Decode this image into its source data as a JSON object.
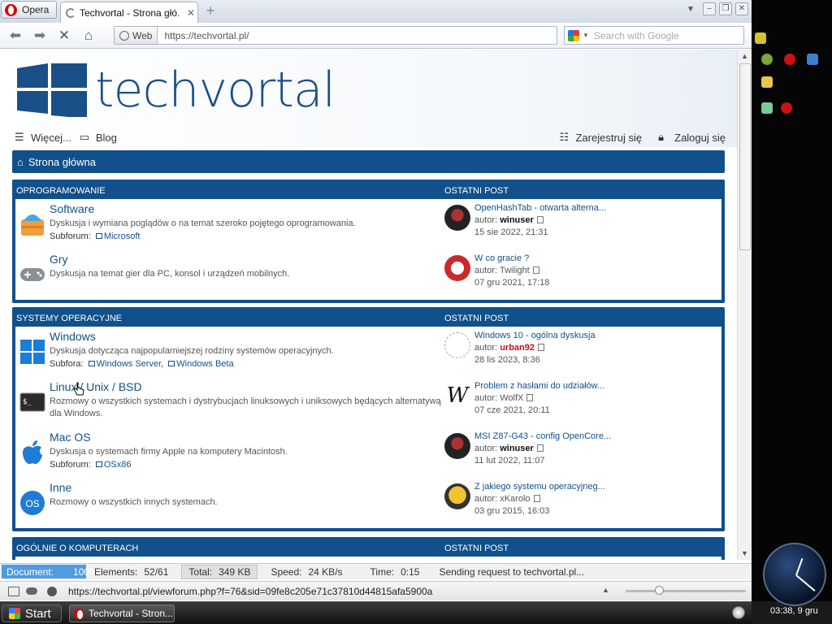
{
  "browser": {
    "menu_label": "Opera",
    "tab_title": "Techvortal - Strona głó...",
    "web_badge": "Web",
    "url": "https://techvortal.pl/",
    "search_placeholder": "Search with Google"
  },
  "site": {
    "logo_text": "techvortal",
    "nav_more": "Więcej...",
    "nav_blog": "Blog",
    "register": "Zarejestruj się",
    "login": "Zaloguj się",
    "breadcrumb": "Strona główna",
    "colors": {
      "primary": "#11508a",
      "author_red": "#c0151b"
    }
  },
  "categories": [
    {
      "title": "OPROGRAMOWANIE",
      "last_post_header": "OSTATNI POST",
      "forums": [
        {
          "icon": "software-box-icon",
          "title": "Software",
          "desc": "Dyskusja i wymiana poglądów o na temat szeroko pojętego oprogramowania.",
          "subforum_label": "Subforum:",
          "subforums": [
            "Microsoft"
          ],
          "last": {
            "title": "OpenHashTab - otwarta alterna...",
            "author_prefix": "autor:",
            "author": "winuser",
            "date": "15 sie 2022, 21:31"
          }
        },
        {
          "icon": "gamepad-icon",
          "title": "Gry",
          "desc": "Dyskusja na temat gier dla PC, konsol i urządzeń mobilnych.",
          "subforum_label": "",
          "subforums": [],
          "last": {
            "title": "W co gracie ?",
            "author_prefix": "autor:",
            "author": "Twilight",
            "date": "07 gru 2021, 17:18"
          }
        }
      ]
    },
    {
      "title": "SYSTEMY OPERACYJNE",
      "last_post_header": "OSTATNI POST",
      "forums": [
        {
          "icon": "windows-logo-icon",
          "title": "Windows",
          "desc": "Dyskusja dotycząca najpopularniejszej rodziny systemów operacyjnych.",
          "subforum_label": "Subfora:",
          "subforums": [
            "Windows Server",
            "Windows Beta"
          ],
          "last": {
            "title": "Windows 10 - ogólna dyskusja",
            "author_prefix": "autor:",
            "author": "urban92",
            "date": "28 lis 2023, 8:36"
          }
        },
        {
          "icon": "terminal-icon",
          "title": "Linux / Unix / BSD",
          "desc": "Rozmowy o wszystkich systemach i dystrybucjach linuksowych i uniksowych będących alternatywą dla Windows.",
          "subforum_label": "",
          "subforums": [],
          "last": {
            "title": "Problem z hasłami do udziałów...",
            "author_prefix": "autor:",
            "author": "WolfX",
            "date": "07 cze 2021, 20:11"
          }
        },
        {
          "icon": "apple-logo-icon",
          "title": "Mac OS",
          "desc": "Dyskusja o systemach firmy Apple na komputery Macintosh.",
          "subforum_label": "Subforum:",
          "subforums": [
            "OSx86"
          ],
          "last": {
            "title": "MSI Z87-G43 - config OpenCore...",
            "author_prefix": "autor:",
            "author": "winuser",
            "date": "11 lut 2022, 11:07"
          }
        },
        {
          "icon": "os-circle-icon",
          "title": "Inne",
          "desc": "Rozmowy o wszystkich innych systemach.",
          "subforum_label": "",
          "subforums": [],
          "last": {
            "title": "Z jakiego systemu operacyjneg...",
            "author_prefix": "autor:",
            "author": "xKarolo",
            "date": "03 gru 2015, 16:03"
          }
        }
      ]
    },
    {
      "title": "OGÓLNIE O KOMPUTERACH",
      "last_post_header": "OSTATNI POST",
      "forums": []
    }
  ],
  "status": {
    "document_label": "Document:",
    "document_progress": "100%",
    "elements_label": "Elements:",
    "elements_value": "52/61",
    "total_label": "Total:",
    "total_value": "349 KB",
    "speed_label": "Speed:",
    "speed_value": "24 KB/s",
    "time_label": "Time:",
    "time_value": "0:15",
    "message": "Sending request to techvortal.pl...",
    "hover_link": "https://techvortal.pl/viewforum.php?f=76&sid=09fe8c205e71c37810d44815afa5900a"
  },
  "taskbar": {
    "start_label": "Start",
    "task_title": "Techvortal - Stron...",
    "clock_text": "03:38, 9 gru"
  }
}
